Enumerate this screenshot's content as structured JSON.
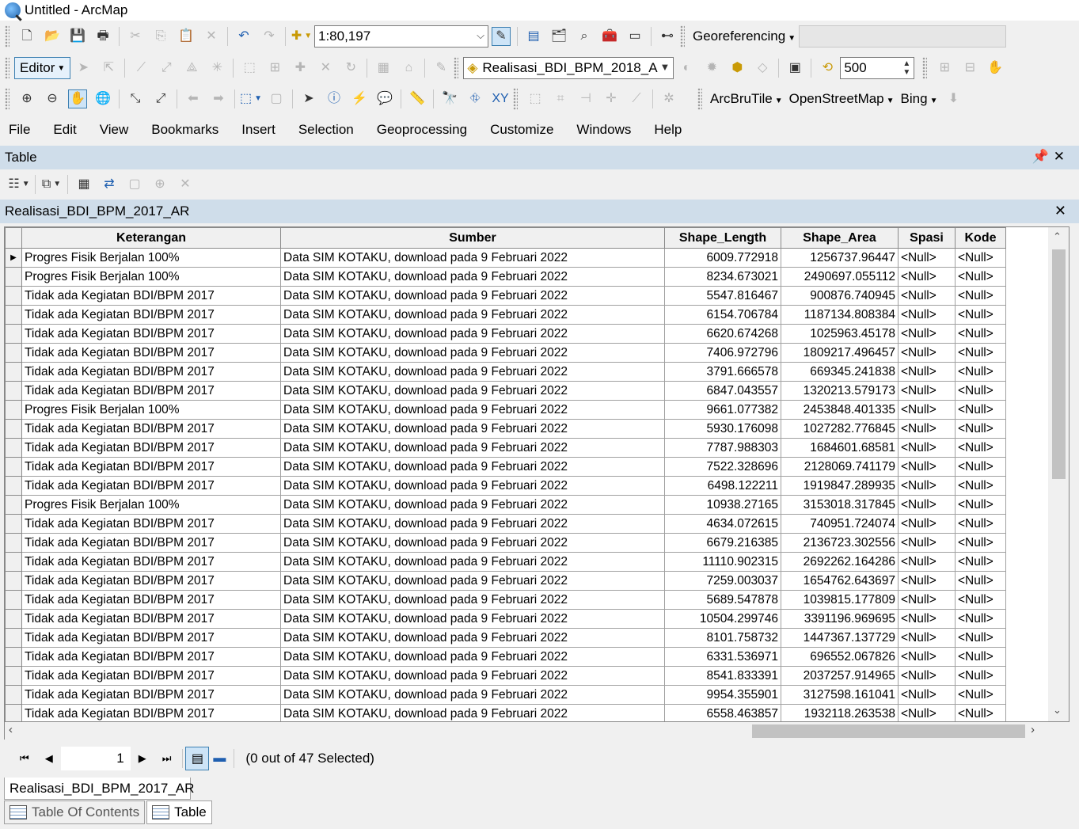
{
  "window": {
    "title": "Untitled - ArcMap"
  },
  "toolbar1": {
    "scale": "1:80,197",
    "georeferencing_label": "Georeferencing"
  },
  "toolbar2": {
    "editor_label": "Editor",
    "layer_combo": "Realisasi_BDI_BPM_2018_A",
    "zoom_value": "500"
  },
  "toolbar3": {
    "arcbrutile_label": "ArcBruTile",
    "openstreetmap_label": "OpenStreetMap",
    "bing_label": "Bing"
  },
  "menu": [
    "File",
    "Edit",
    "View",
    "Bookmarks",
    "Insert",
    "Selection",
    "Geoprocessing",
    "Customize",
    "Windows",
    "Help"
  ],
  "panel": {
    "title": "Table"
  },
  "table": {
    "name": "Realisasi_BDI_BPM_2017_AR",
    "columns": [
      "Keterangan",
      "Sumber",
      "Shape_Length",
      "Shape_Area",
      "Spasi",
      "Kode"
    ],
    "rows": [
      [
        "Progres Fisik Berjalan 100%",
        "Data SIM KOTAKU, download pada 9 Februari 2022",
        "6009.772918",
        "1256737.96447",
        "<Null>",
        "<Null>"
      ],
      [
        "Progres Fisik Berjalan 100%",
        "Data SIM KOTAKU, download pada 9 Februari 2022",
        "8234.673021",
        "2490697.055112",
        "<Null>",
        "<Null>"
      ],
      [
        "Tidak ada Kegiatan BDI/BPM 2017",
        "Data SIM KOTAKU, download pada 9 Februari 2022",
        "5547.816467",
        "900876.740945",
        "<Null>",
        "<Null>"
      ],
      [
        "Tidak ada Kegiatan BDI/BPM 2017",
        "Data SIM KOTAKU, download pada 9 Februari 2022",
        "6154.706784",
        "1187134.808384",
        "<Null>",
        "<Null>"
      ],
      [
        "Tidak ada Kegiatan BDI/BPM 2017",
        "Data SIM KOTAKU, download pada 9 Februari 2022",
        "6620.674268",
        "1025963.45178",
        "<Null>",
        "<Null>"
      ],
      [
        "Tidak ada Kegiatan BDI/BPM 2017",
        "Data SIM KOTAKU, download pada 9 Februari 2022",
        "7406.972796",
        "1809217.496457",
        "<Null>",
        "<Null>"
      ],
      [
        "Tidak ada Kegiatan BDI/BPM 2017",
        "Data SIM KOTAKU, download pada 9 Februari 2022",
        "3791.666578",
        "669345.241838",
        "<Null>",
        "<Null>"
      ],
      [
        "Tidak ada Kegiatan BDI/BPM 2017",
        "Data SIM KOTAKU, download pada 9 Februari 2022",
        "6847.043557",
        "1320213.579173",
        "<Null>",
        "<Null>"
      ],
      [
        "Progres Fisik Berjalan 100%",
        "Data SIM KOTAKU, download pada 9 Februari 2022",
        "9661.077382",
        "2453848.401335",
        "<Null>",
        "<Null>"
      ],
      [
        "Tidak ada Kegiatan BDI/BPM 2017",
        "Data SIM KOTAKU, download pada 9 Februari 2022",
        "5930.176098",
        "1027282.776845",
        "<Null>",
        "<Null>"
      ],
      [
        "Tidak ada Kegiatan BDI/BPM 2017",
        "Data SIM KOTAKU, download pada 9 Februari 2022",
        "7787.988303",
        "1684601.68581",
        "<Null>",
        "<Null>"
      ],
      [
        "Tidak ada Kegiatan BDI/BPM 2017",
        "Data SIM KOTAKU, download pada 9 Februari 2022",
        "7522.328696",
        "2128069.741179",
        "<Null>",
        "<Null>"
      ],
      [
        "Tidak ada Kegiatan BDI/BPM 2017",
        "Data SIM KOTAKU, download pada 9 Februari 2022",
        "6498.122211",
        "1919847.289935",
        "<Null>",
        "<Null>"
      ],
      [
        "Progres Fisik Berjalan 100%",
        "Data SIM KOTAKU, download pada 9 Februari 2022",
        "10938.27165",
        "3153018.317845",
        "<Null>",
        "<Null>"
      ],
      [
        "Tidak ada Kegiatan BDI/BPM 2017",
        "Data SIM KOTAKU, download pada 9 Februari 2022",
        "4634.072615",
        "740951.724074",
        "<Null>",
        "<Null>"
      ],
      [
        "Tidak ada Kegiatan BDI/BPM 2017",
        "Data SIM KOTAKU, download pada 9 Februari 2022",
        "6679.216385",
        "2136723.302556",
        "<Null>",
        "<Null>"
      ],
      [
        "Tidak ada Kegiatan BDI/BPM 2017",
        "Data SIM KOTAKU, download pada 9 Februari 2022",
        "11110.902315",
        "2692262.164286",
        "<Null>",
        "<Null>"
      ],
      [
        "Tidak ada Kegiatan BDI/BPM 2017",
        "Data SIM KOTAKU, download pada 9 Februari 2022",
        "7259.003037",
        "1654762.643697",
        "<Null>",
        "<Null>"
      ],
      [
        "Tidak ada Kegiatan BDI/BPM 2017",
        "Data SIM KOTAKU, download pada 9 Februari 2022",
        "5689.547878",
        "1039815.177809",
        "<Null>",
        "<Null>"
      ],
      [
        "Tidak ada Kegiatan BDI/BPM 2017",
        "Data SIM KOTAKU, download pada 9 Februari 2022",
        "10504.299746",
        "3391196.969695",
        "<Null>",
        "<Null>"
      ],
      [
        "Tidak ada Kegiatan BDI/BPM 2017",
        "Data SIM KOTAKU, download pada 9 Februari 2022",
        "8101.758732",
        "1447367.137729",
        "<Null>",
        "<Null>"
      ],
      [
        "Tidak ada Kegiatan BDI/BPM 2017",
        "Data SIM KOTAKU, download pada 9 Februari 2022",
        "6331.536971",
        "696552.067826",
        "<Null>",
        "<Null>"
      ],
      [
        "Tidak ada Kegiatan BDI/BPM 2017",
        "Data SIM KOTAKU, download pada 9 Februari 2022",
        "8541.833391",
        "2037257.914965",
        "<Null>",
        "<Null>"
      ],
      [
        "Tidak ada Kegiatan BDI/BPM 2017",
        "Data SIM KOTAKU, download pada 9 Februari 2022",
        "9954.355901",
        "3127598.161041",
        "<Null>",
        "<Null>"
      ],
      [
        "Tidak ada Kegiatan BDI/BPM 2017",
        "Data SIM KOTAKU, download pada 9 Februari 2022",
        "6558.463857",
        "1932118.263538",
        "<Null>",
        "<Null>"
      ]
    ]
  },
  "navigation": {
    "current_record": "1",
    "selection_status": "(0 out of 47 Selected)"
  },
  "bottom_tab": {
    "label": "Realisasi_BDI_BPM_2017_AR"
  },
  "dock_tabs": [
    "Table Of Contents",
    "Table"
  ]
}
